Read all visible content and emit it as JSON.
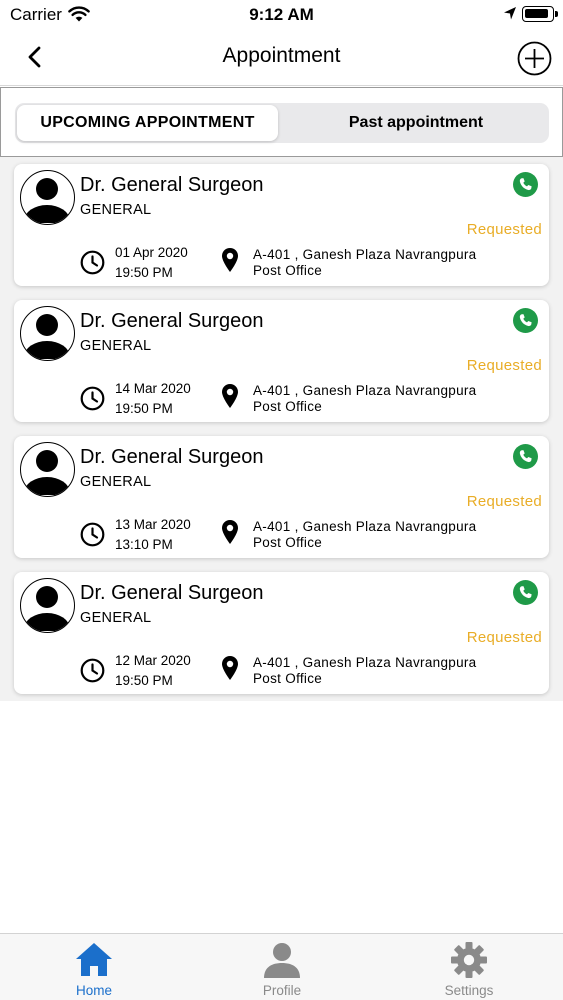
{
  "status_bar": {
    "carrier": "Carrier",
    "time": "9:12 AM"
  },
  "nav": {
    "title": "Appointment"
  },
  "segments": {
    "upcoming": "UPCOMING APPOINTMENT",
    "past": "Past appointment"
  },
  "colors": {
    "call": "#1f9a48",
    "requested": "#e9ad27",
    "active_tab": "#1b6fcb",
    "inactive_tab": "#8a8a8a"
  },
  "appointments": [
    {
      "doctor": "Dr. General Surgeon",
      "specialty": "GENERAL",
      "status": "Requested",
      "date": "01 Apr 2020",
      "time": "19:50 PM",
      "address_line1": "A-401 , Ganesh Plaza Navrangpura",
      "address_line2": "Post Office"
    },
    {
      "doctor": "Dr. General Surgeon",
      "specialty": "GENERAL",
      "status": "Requested",
      "date": "14 Mar 2020",
      "time": "19:50 PM",
      "address_line1": "A-401 , Ganesh Plaza Navrangpura",
      "address_line2": "Post Office"
    },
    {
      "doctor": "Dr. General Surgeon",
      "specialty": "GENERAL",
      "status": "Requested",
      "date": "13 Mar 2020",
      "time": "13:10 PM",
      "address_line1": "A-401 , Ganesh Plaza Navrangpura",
      "address_line2": "Post Office"
    },
    {
      "doctor": "Dr. General Surgeon",
      "specialty": "GENERAL",
      "status": "Requested",
      "date": "12 Mar 2020",
      "time": "19:50 PM",
      "address_line1": "A-401 , Ganesh Plaza Navrangpura",
      "address_line2": "Post Office"
    }
  ],
  "tabs": [
    {
      "label": "Home",
      "icon": "home-icon"
    },
    {
      "label": "Profile",
      "icon": "person-icon"
    },
    {
      "label": "Settings",
      "icon": "gear-icon"
    }
  ]
}
